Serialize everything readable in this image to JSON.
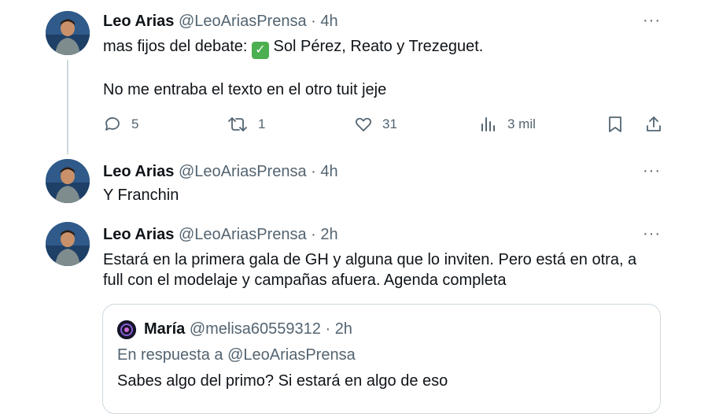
{
  "tweets": [
    {
      "name": "Leo Arias",
      "handle": "@LeoAriasPrensa",
      "sep": " · ",
      "time": "4h",
      "line1_pre": "mas fijos del debate: ",
      "check_icon": "✓",
      "line1_post": " Sol Pérez, Reato y Trezeguet.",
      "line2": "No me entraba el texto en el otro tuit jeje",
      "replies": "5",
      "retweets": "1",
      "likes": "31",
      "views": "3 mil"
    },
    {
      "name": "Leo Arias",
      "handle": "@LeoAriasPrensa",
      "sep": " · ",
      "time": "4h",
      "text": "Y Franchin"
    },
    {
      "name": "Leo Arias",
      "handle": "@LeoAriasPrensa",
      "sep": " · ",
      "time": "2h",
      "text_line1": "Estará en la primera gala de GH y alguna que lo inviten. Pero está en otra, a",
      "text_line2": "full con el modelaje y campañas afuera. Agenda completa"
    }
  ],
  "quote": {
    "name": "María",
    "handle": "@melisa60559312",
    "sep": " · ",
    "time": "2h",
    "reply_prefix": "En respuesta a ",
    "reply_to": "@LeoAriasPrensa",
    "text": "Sabes algo del primo? Si estará en algo de eso"
  },
  "ui": {
    "more_label": "···"
  }
}
